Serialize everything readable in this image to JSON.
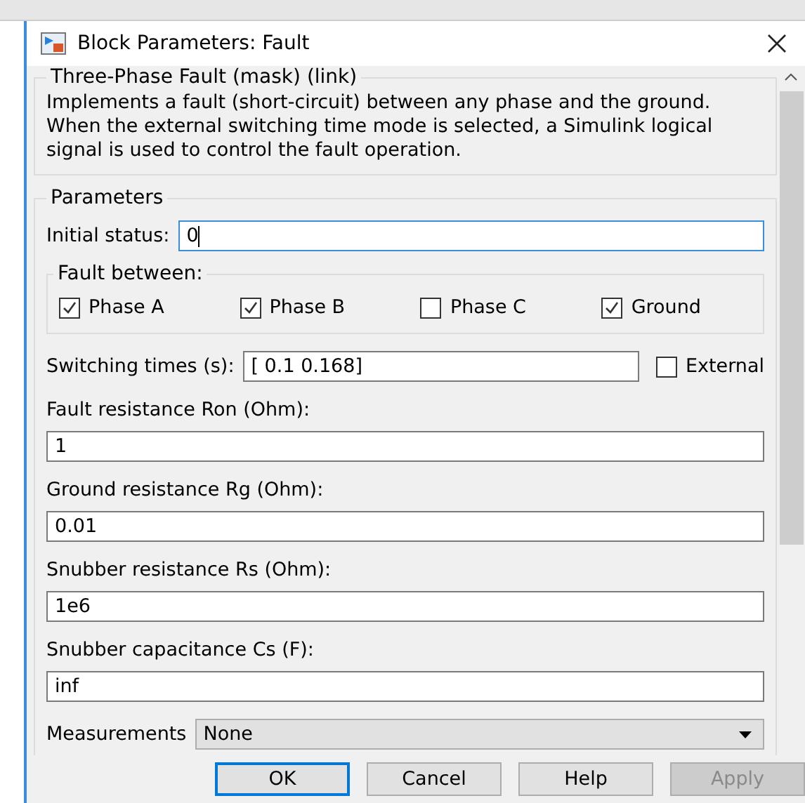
{
  "window": {
    "title": "Block Parameters: Fault"
  },
  "description": {
    "title": "Three-Phase Fault (mask) (link)",
    "text": "Implements a fault (short-circuit) between any phase and the ground. When the external switching time mode is selected, a Simulink logical signal is used to control the fault operation."
  },
  "parameters": {
    "title": "Parameters",
    "initial_status": {
      "label": "Initial status:",
      "value": "0",
      "focused": true
    },
    "fault_between": {
      "title": "Fault between:",
      "options": [
        {
          "label": "Phase A",
          "checked": true
        },
        {
          "label": "Phase B",
          "checked": true
        },
        {
          "label": "Phase C",
          "checked": false
        },
        {
          "label": "Ground",
          "checked": true
        }
      ]
    },
    "switching_times": {
      "label": "Switching times (s):",
      "value": "[ 0.1 0.168]",
      "external": {
        "label": "External",
        "checked": false
      }
    },
    "fields": [
      {
        "label": "Fault resistance Ron (Ohm):",
        "value": "1"
      },
      {
        "label": "Ground resistance Rg (Ohm):",
        "value": "0.01"
      },
      {
        "label": "Snubber resistance Rs (Ohm):",
        "value": "1e6"
      },
      {
        "label": "Snubber capacitance Cs (F):",
        "value": "inf"
      }
    ],
    "measurements": {
      "label": "Measurements",
      "value": "None"
    }
  },
  "buttons": [
    {
      "label": "OK",
      "focused": true,
      "disabled": false
    },
    {
      "label": "Cancel",
      "focused": false,
      "disabled": false
    },
    {
      "label": "Help",
      "focused": false,
      "disabled": false
    },
    {
      "label": "Apply",
      "focused": false,
      "disabled": true
    }
  ]
}
